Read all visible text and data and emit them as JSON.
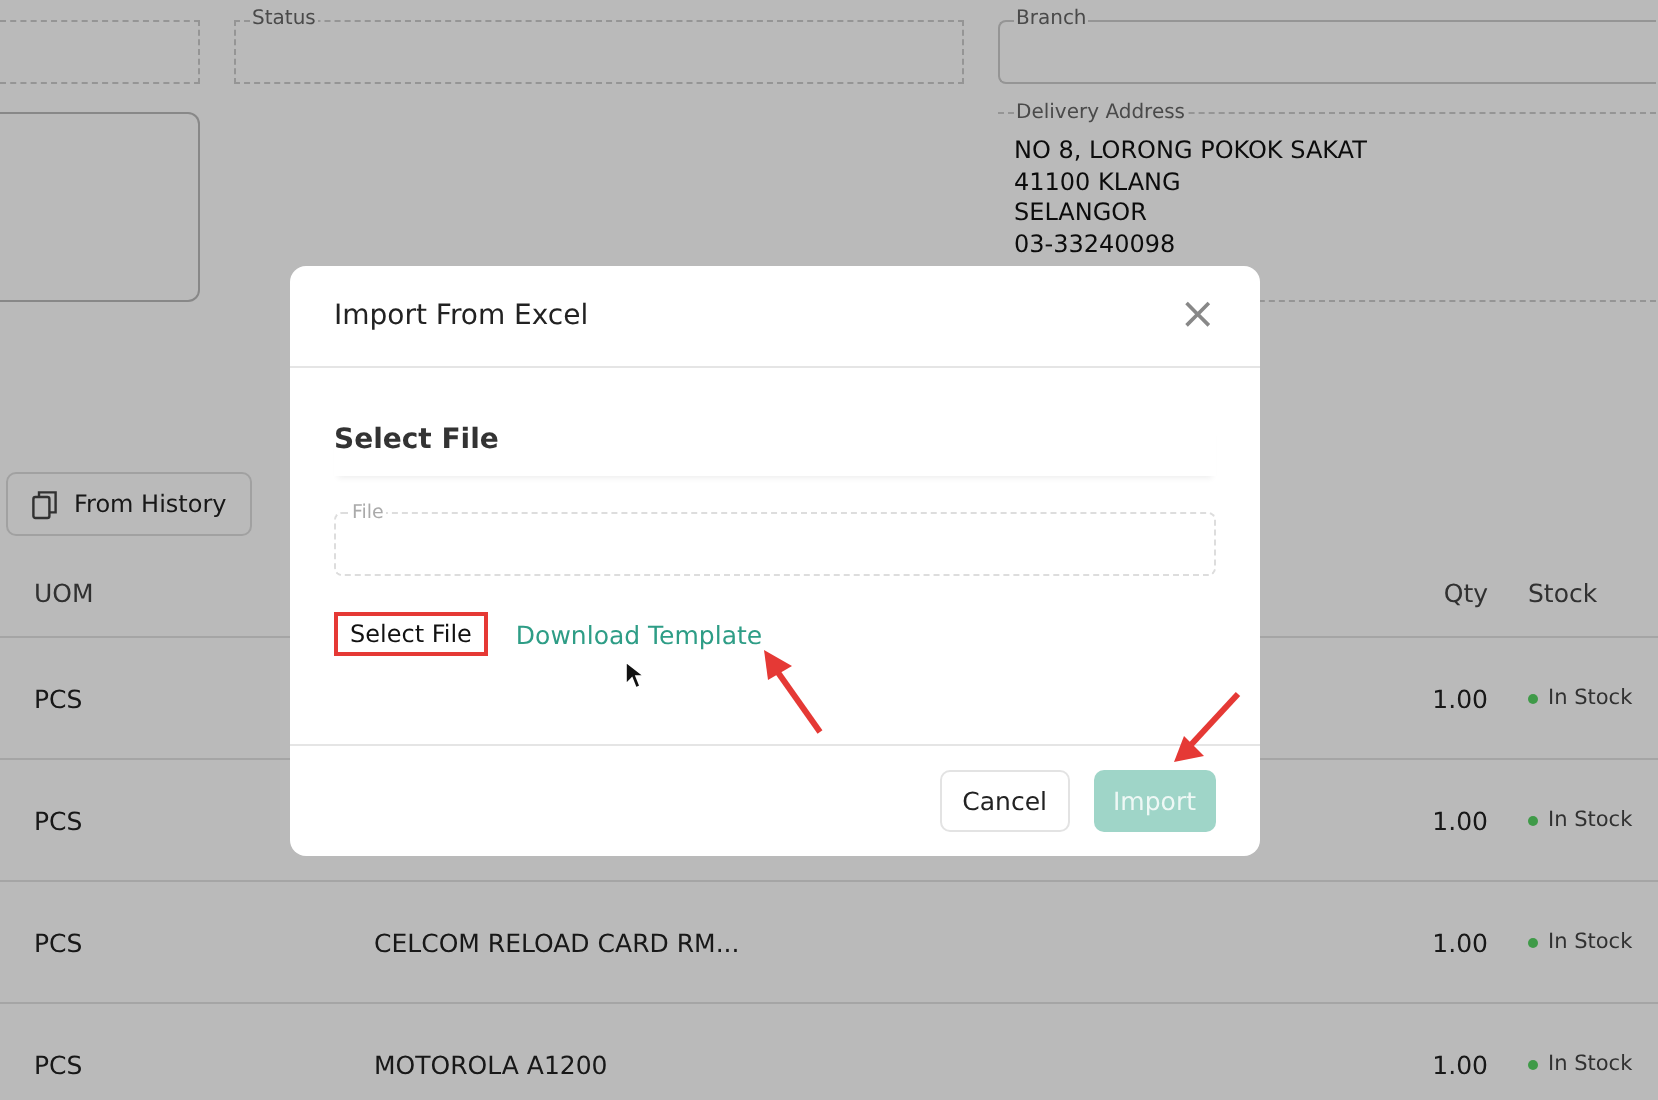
{
  "form": {
    "fields": [
      {
        "kind": "plain"
      },
      {
        "kind": "dashed",
        "label": "Status"
      },
      {
        "kind": "solid",
        "label": "Branch"
      },
      {
        "kind": "area"
      },
      {
        "kind": "address",
        "label": "Delivery Address",
        "lines": [
          "NO 8, LORONG POKOK SAKAT",
          "41100 KLANG",
          "SELANGOR",
          "03-33240098"
        ]
      }
    ]
  },
  "toolbar": {
    "buttons": [
      {
        "label": "From History"
      }
    ]
  },
  "table": {
    "columns": [
      "UOM",
      "Qty",
      "Stock"
    ],
    "rows": [
      {
        "uom": "PCS",
        "qty": "1.00",
        "stock": "In Stock",
        "color": "#3f9a48"
      },
      {
        "uom": "PCS",
        "qty": "1.00",
        "stock": "In Stock",
        "color": "#3f9a48"
      },
      {
        "uom": "PCS",
        "description": "CELCOM RELOAD CARD RM...",
        "qty": "1.00",
        "stock": "In Stock",
        "color": "#3f9a48"
      },
      {
        "uom": "PCS",
        "description": "MOTOROLA A1200",
        "qty": "1.00",
        "stock": "In Stock",
        "color": "#3f9a48"
      }
    ]
  },
  "dialog": {
    "title": "Import From Excel",
    "close": "×",
    "section_title": "Select File",
    "file_field": {
      "label": "File"
    },
    "select_button": "Select File",
    "template_link": "Download Template",
    "buttons": [
      {
        "label": "Cancel",
        "kind": "secondary",
        "disabled": false
      },
      {
        "label": "Import",
        "kind": "primary",
        "disabled": true
      }
    ]
  }
}
